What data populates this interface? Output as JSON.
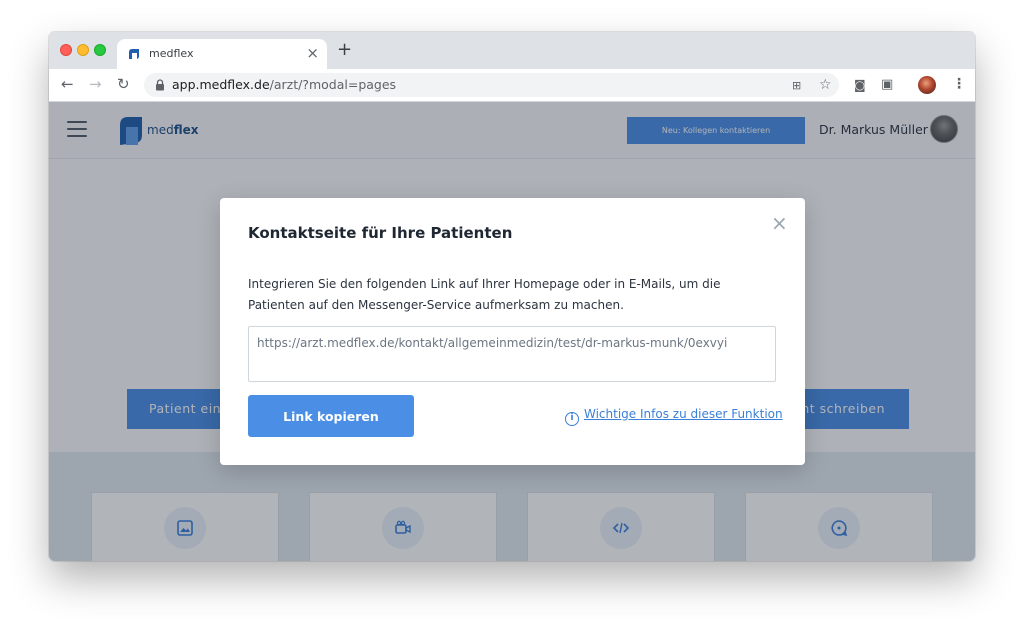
{
  "browser": {
    "tab": {
      "title": "medflex",
      "close": "×"
    },
    "new_tab": "+",
    "url_host": "app.medflex.de",
    "url_path": "/arzt/?modal=pages"
  },
  "app": {
    "logo_prefix": "med",
    "logo_suffix": "flex",
    "colleague_button": "Neu: Kollegen kontaktieren",
    "user_name": "Dr. Markus Müller",
    "hero_left_button": "Patient ein",
    "hero_right_button": "ht schreiben"
  },
  "modal": {
    "title": "Kontaktseite für Ihre Patienten",
    "close": "×",
    "description": "Integrieren Sie den folgenden Link auf Ihrer Homepage oder in E-Mails, um die Patienten auf den Messenger-Service aufmerksam zu machen.",
    "link_value": "https://arzt.medflex.de/kontakt/allgemeinmedizin/test/dr-markus-munk/0exvyi",
    "copy_button": "Link kopieren",
    "info_link": "Wichtige Infos zu dieser Funktion"
  },
  "colors": {
    "accent": "#4a8ee6",
    "link": "#3a7fd9",
    "brand": "#1a4f8a"
  },
  "icons": {
    "cards": [
      "image-icon",
      "video-camera-icon",
      "code-icon",
      "chat-bubble-icon"
    ]
  }
}
